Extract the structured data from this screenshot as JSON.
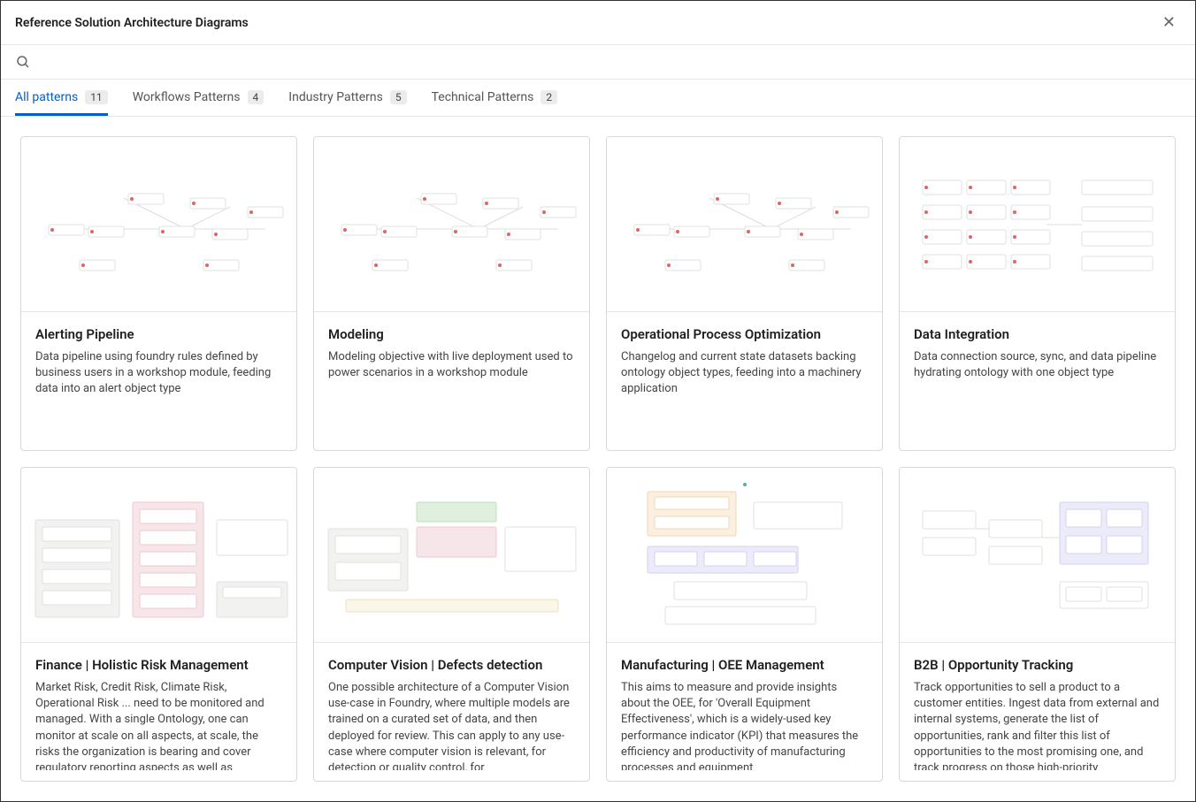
{
  "dialog": {
    "title": "Reference Solution Architecture Diagrams"
  },
  "search": {
    "placeholder": ""
  },
  "tabs": [
    {
      "label": "All patterns",
      "count": "11",
      "active": true
    },
    {
      "label": "Workflows Patterns",
      "count": "4",
      "active": false
    },
    {
      "label": "Industry Patterns",
      "count": "5",
      "active": false
    },
    {
      "label": "Technical Patterns",
      "count": "2",
      "active": false
    }
  ],
  "cards": [
    {
      "title": "Alerting Pipeline",
      "desc": "Data pipeline using foundry rules defined by business users in a workshop module, feeding data into an alert object type",
      "thumb": "gray-flow"
    },
    {
      "title": "Modeling",
      "desc": "Modeling objective with live deployment used to power scenarios in a workshop module",
      "thumb": "gray-flow"
    },
    {
      "title": "Operational Process Optimization",
      "desc": "Changelog and current state datasets backing ontology object types, feeding into a machinery application",
      "thumb": "gray-flow"
    },
    {
      "title": "Data Integration",
      "desc": "Data connection source, sync, and data pipeline hydrating ontology with one object type",
      "thumb": "gray-grid"
    },
    {
      "title": "Finance | Holistic Risk Management",
      "desc": "Market Risk, Credit Risk, Climate Risk, Operational Risk ... need to be monitored and managed. With a single Ontology, one can monitor at scale on all aspects, at scale, the risks the organization is bearing and cover regulatory reporting aspects as well as",
      "thumb": "pink-boxes"
    },
    {
      "title": "Computer Vision | Defects detection",
      "desc": "One possible architecture of a Computer Vision use-case in Foundry, where multiple models are trained on a curated set of data, and then deployed for review. This can apply to any use-case where computer vision is relevant, for detection or quality control, for",
      "thumb": "green-pink"
    },
    {
      "title": "Manufacturing | OEE Management",
      "desc": "This aims to measure and provide insights about the OEE, for 'Overall Equipment Effectiveness', which is a widely-used key performance indicator (KPI) that measures the efficiency and productivity of manufacturing processes and equipment",
      "thumb": "orange-purple"
    },
    {
      "title": "B2B | Opportunity Tracking",
      "desc": "Track opportunities to sell a product to a customer entities. Ingest data from external and internal systems, generate the list of opportunities, rank and filter this list of opportunities to the most promising one, and track progress on those high-priority",
      "thumb": "purple-boxes"
    }
  ]
}
